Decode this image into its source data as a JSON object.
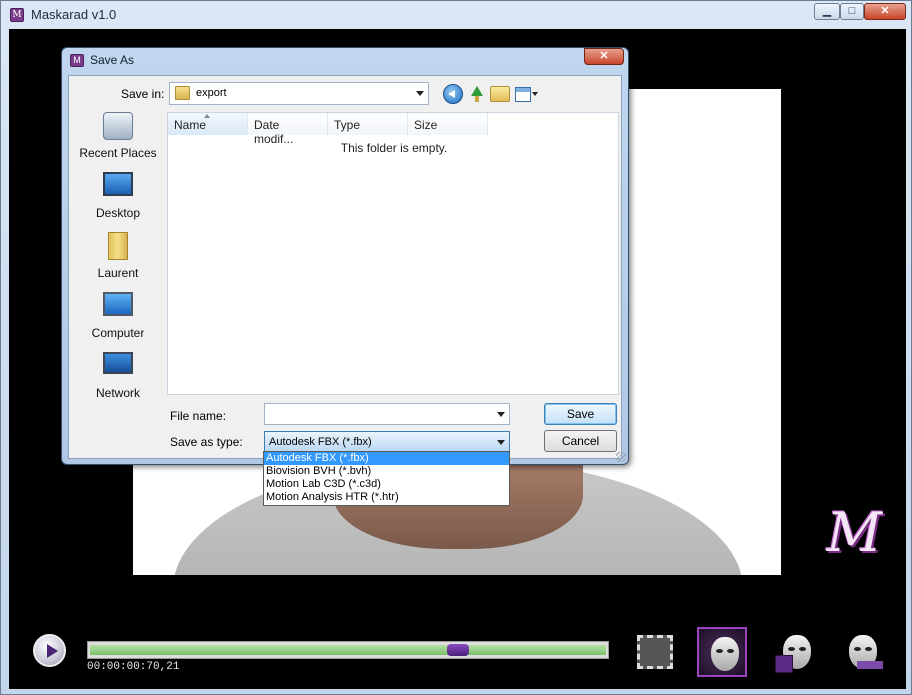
{
  "app": {
    "title": "Maskarad v1.0",
    "icon_name": "maskarad-app-icon",
    "window_buttons": {
      "minimize": "▁",
      "maximize": "□",
      "close": "✕"
    }
  },
  "player": {
    "timecode": "00:00:00:70,21",
    "progress_fraction": 0.713,
    "logo_letter": "M"
  },
  "dialog": {
    "title": "Save As",
    "close_glyph": "✕",
    "save_in_label": "Save in:",
    "save_in_value": "export",
    "places": [
      {
        "label": "Recent Places",
        "icon": "recent-places-icon"
      },
      {
        "label": "Desktop",
        "icon": "desktop-icon"
      },
      {
        "label": "Laurent",
        "icon": "user-folder-icon"
      },
      {
        "label": "Computer",
        "icon": "computer-icon"
      },
      {
        "label": "Network",
        "icon": "network-icon"
      }
    ],
    "columns": [
      "Name",
      "Date modif...",
      "Type",
      "Size"
    ],
    "empty_message": "This folder is empty.",
    "file_name_label": "File name:",
    "file_name_value": "",
    "save_as_type_label": "Save as type:",
    "save_as_type_value": "Autodesk FBX (*.fbx)",
    "save_button": "Save",
    "cancel_button": "Cancel",
    "type_options": [
      "Autodesk FBX (*.fbx)",
      "Biovision BVH (*.bvh)",
      "Motion Lab C3D (*.c3d)",
      "Motion Analysis HTR (*.htr)"
    ]
  },
  "colors": {
    "accent": "#3399ff",
    "brand": "#7b2d86",
    "progress": "#7cc06a"
  }
}
